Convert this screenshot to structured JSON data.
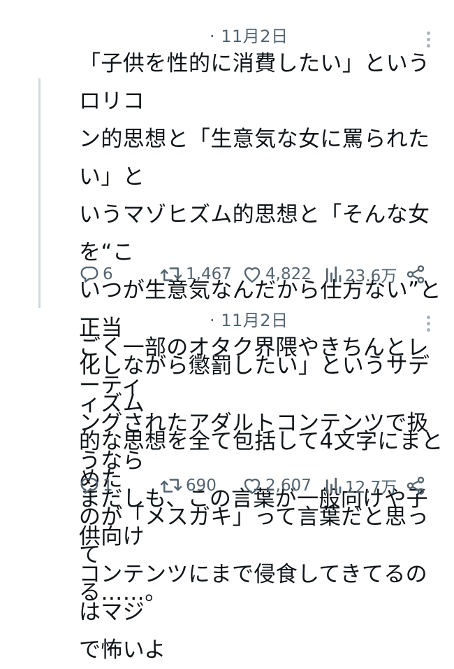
{
  "tweets": [
    {
      "timestamp": "· 11月2日",
      "text_lines": [
        "「子供を性的に消費したい」というロリコ",
        "ン的思想と「生意気な女に罵られたい」と",
        "いうマゾヒズム的思想と「そんな女を“こ",
        "いつが生意気なんだから仕方ない”と正当",
        "化しながら懲罰したい」というサディズム",
        "的な思想を全て包括して4文字にまとめた",
        "のが「メスガキ」って言葉だと思って",
        "る……。"
      ],
      "replies": "6",
      "retweets": "1,467",
      "likes": "4,822",
      "views": "23.6万"
    },
    {
      "timestamp": "· 11月2日",
      "text_lines": [
        "ごく一部のオタク界隈やきちんとレーティ",
        "ングされたアダルトコンテンツで扱うなら",
        "まだしも、この言葉が一般向けや子供向け",
        "コンテンツにまで侵食してきてるのはマジ",
        "で怖いよ"
      ],
      "replies": "1",
      "retweets": "690",
      "likes": "2,607",
      "views": "12.7万"
    }
  ],
  "colors": {
    "text": "#0f1419",
    "muted": "#536471",
    "thread_line": "#cfd9de"
  },
  "icons": [
    "reply-icon",
    "retweet-icon",
    "like-icon",
    "views-icon",
    "share-icon",
    "more-icon"
  ]
}
